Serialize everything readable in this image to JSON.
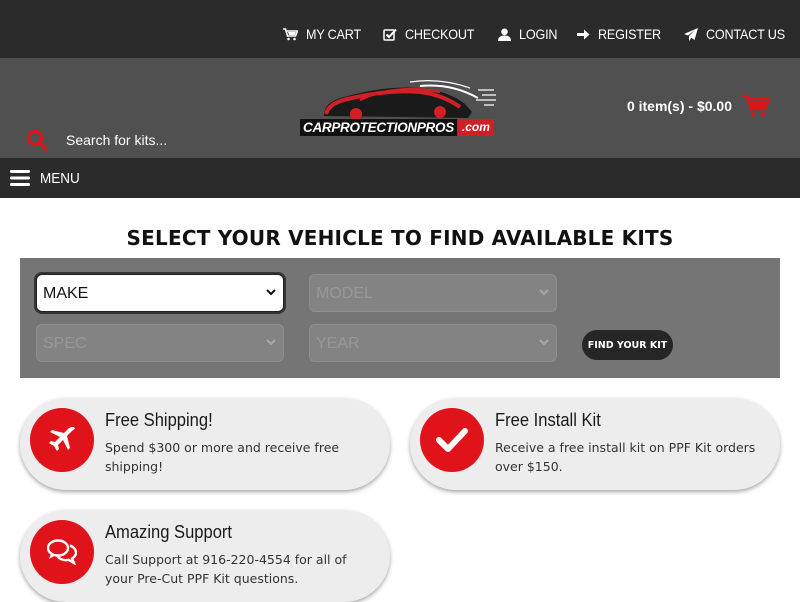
{
  "topnav": {
    "items": [
      {
        "label": "MY CART",
        "icon": "cart-icon"
      },
      {
        "label": "CHECKOUT",
        "icon": "checkbox-icon"
      },
      {
        "label": "LOGIN",
        "icon": "user-icon"
      },
      {
        "label": "REGISTER",
        "icon": "arrow-right-icon"
      },
      {
        "label": "CONTACT US",
        "icon": "paper-plane-icon"
      }
    ]
  },
  "header": {
    "search_placeholder": "Search for kits...",
    "logo_main": "CARPROTECTIONPROS",
    "logo_suffix": ".com",
    "cart_summary": "0 item(s) - $0.00"
  },
  "menu": {
    "label": "MENU"
  },
  "main": {
    "title": "SELECT YOUR VEHICLE TO FIND AVAILABLE KITS",
    "finder": {
      "make": "MAKE",
      "model": "MODEL",
      "spec": "SPEC",
      "year": "YEAR",
      "button": "FIND YOUR KIT"
    }
  },
  "features": [
    {
      "title": "Free Shipping!",
      "desc": "Spend $300 or more and receive free shipping!",
      "icon": "airplane-icon"
    },
    {
      "title": "Free Install Kit",
      "desc": "Receive a free install kit on PPF Kit orders over $150.",
      "icon": "checkmark-icon"
    },
    {
      "title": "Amazing Support",
      "desc": "Call Support at 916-220-4554 for all of your Pre-Cut PPF Kit questions.",
      "icon": "chat-bubbles-icon"
    }
  ],
  "colors": {
    "topbar": "#2b2b2b",
    "header": "#505050",
    "finder_panel": "#757575",
    "accent_red": "#e0131b",
    "card_bg": "#ededed"
  }
}
